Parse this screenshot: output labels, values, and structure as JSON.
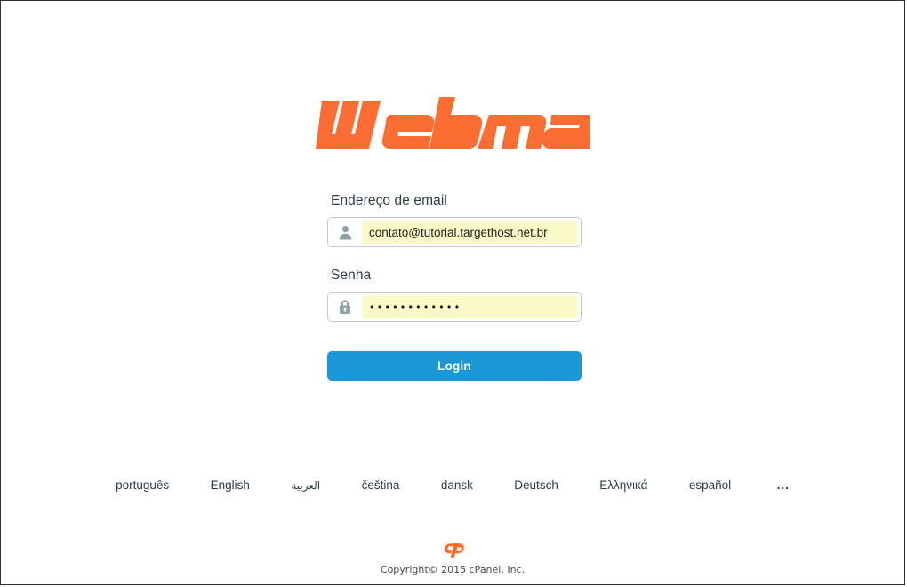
{
  "brand": {
    "logo_text": "Webmail",
    "logo_color": "#fb6d33",
    "accent_button_color": "#1b97d5",
    "label_color": "#2b3d4f",
    "autofill_color": "#fafac8"
  },
  "form": {
    "email": {
      "label": "Endereço de email",
      "icon": "user-icon",
      "value": "contato@tutorial.targethost.net.br",
      "placeholder": "Endereço de email"
    },
    "password": {
      "label": "Senha",
      "icon": "lock-icon",
      "value": "••••••••••••",
      "placeholder": "Senha"
    },
    "submit_label": "Login"
  },
  "languages": [
    {
      "label": "português"
    },
    {
      "label": "English"
    },
    {
      "label": "العربية"
    },
    {
      "label": "čeština"
    },
    {
      "label": "dansk"
    },
    {
      "label": "Deutsch"
    },
    {
      "label": "Ελληνικά"
    },
    {
      "label": "español"
    },
    {
      "label": "..."
    }
  ],
  "footer": {
    "logo": "cp-logo-icon",
    "copyright": "Copyright© 2015 cPanel, Inc."
  }
}
